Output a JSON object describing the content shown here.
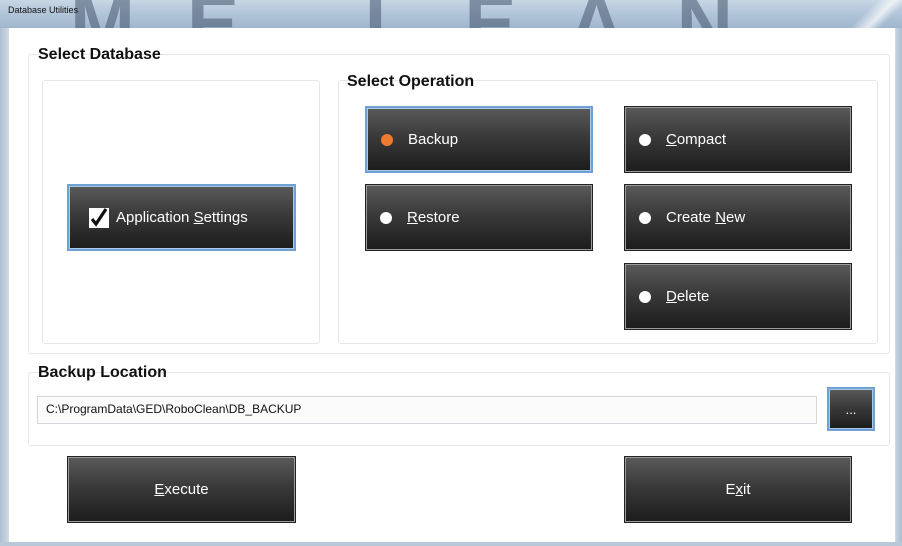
{
  "window": {
    "title": "Database Utilities",
    "watermark": "ME LEAN"
  },
  "select_database": {
    "label": "Select Database",
    "application_settings": {
      "label": "Application Settings",
      "mnemonic_before": "Application ",
      "mnemonic": "S",
      "mnemonic_after": "ettings",
      "checked": true
    }
  },
  "select_operation": {
    "label": "Select Operation",
    "backup": {
      "label": "Backup",
      "selected": true
    },
    "compact": {
      "before": "",
      "mnemonic": "C",
      "after": "ompact",
      "selected": false
    },
    "restore": {
      "before": "",
      "mnemonic": "R",
      "after": "estore",
      "selected": false
    },
    "create_new": {
      "before": "Create ",
      "mnemonic": "N",
      "after": "ew",
      "selected": false
    },
    "delete": {
      "before": "",
      "mnemonic": "D",
      "after": "elete",
      "selected": false
    }
  },
  "backup_location": {
    "label": "Backup Location",
    "path": "C:\\ProgramData\\GED\\RoboClean\\DB_BACKUP",
    "browse_label": "..."
  },
  "actions": {
    "execute": {
      "before": "",
      "mnemonic": "E",
      "after": "xecute"
    },
    "exit": {
      "before": "E",
      "mnemonic": "x",
      "after": "it"
    }
  },
  "colors": {
    "radio_selected": "#ee7b30",
    "selected_border": "#6f9fd3"
  }
}
